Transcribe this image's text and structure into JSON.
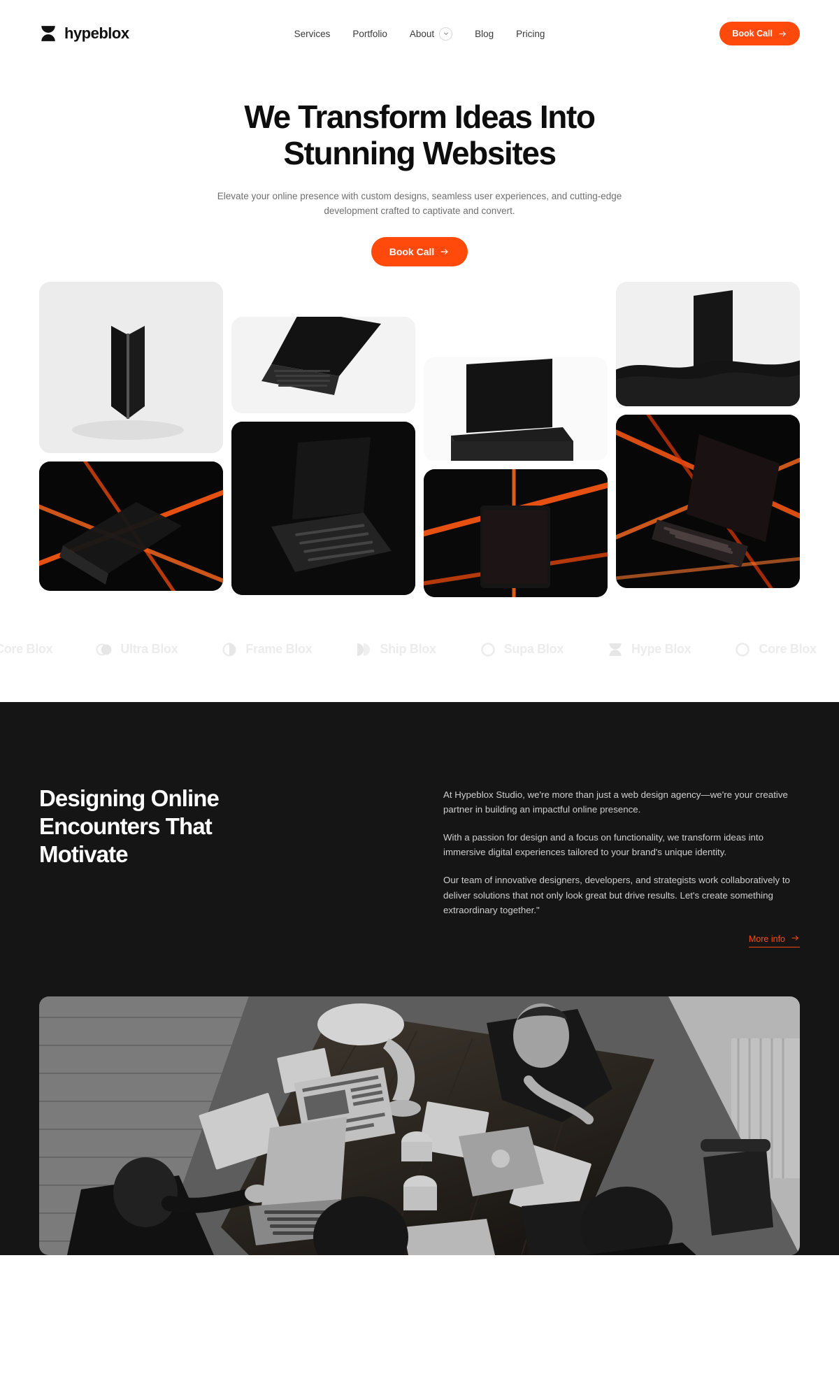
{
  "header": {
    "logo_icon": "hourglass-icon",
    "brand": "hypeblox",
    "nav": [
      {
        "label": "Services",
        "has_dropdown": false
      },
      {
        "label": "Portfolio",
        "has_dropdown": false
      },
      {
        "label": "About",
        "has_dropdown": true,
        "dropdown_icon": "chevron-down-icon"
      },
      {
        "label": "Blog",
        "has_dropdown": false
      },
      {
        "label": "Pricing",
        "has_dropdown": false
      }
    ],
    "cta": {
      "label": "Book Call",
      "icon": "arrow-right-icon"
    }
  },
  "hero": {
    "title_line1": "We Transform Ideas Into",
    "title_line2": "Stunning Websites",
    "subtitle": "Elevate your online presence with custom designs, seamless user experiences, and cutting-edge development crafted to captivate and convert.",
    "cta": {
      "label": "Book Call",
      "icon": "arrow-right-icon"
    }
  },
  "gallery": {
    "tiles": [
      {
        "id": "tile-1",
        "alt": "folded-black-phone-on-light-background",
        "style": "light"
      },
      {
        "id": "tile-2",
        "alt": "open-black-laptop-angled-on-light-background",
        "style": "light"
      },
      {
        "id": "tile-3",
        "alt": "black-laptop-standing-on-stone-block",
        "style": "light"
      },
      {
        "id": "tile-4",
        "alt": "black-phone-standing-on-fur-surface",
        "style": "light"
      },
      {
        "id": "tile-5",
        "alt": "laptop-with-orange-neon-light-streaks",
        "style": "dark"
      },
      {
        "id": "tile-6",
        "alt": "open-laptop-in-dark-studio-lighting",
        "style": "dark"
      },
      {
        "id": "tile-7",
        "alt": "tablet-with-orange-neon-light-streaks",
        "style": "dark"
      },
      {
        "id": "tile-8",
        "alt": "laptop-with-red-neon-light-streaks",
        "style": "dark"
      }
    ]
  },
  "marquee": {
    "items": [
      {
        "label": "Core Blox",
        "icon": "circle-outline-icon"
      },
      {
        "label": "Ultra Blox",
        "icon": "two-circles-icon"
      },
      {
        "label": "Frame Blox",
        "icon": "half-circle-icon"
      },
      {
        "label": "Ship Blox",
        "icon": "double-chevron-icon"
      },
      {
        "label": "Supa Blox",
        "icon": "circle-outline-icon"
      },
      {
        "label": "Hype Blox",
        "icon": "hourglass-icon"
      },
      {
        "label": "Core Blox",
        "icon": "circle-outline-icon"
      }
    ]
  },
  "about": {
    "title_line1": "Designing Online",
    "title_line2": "Encounters That",
    "title_line3": "Motivate",
    "paragraphs": [
      "At Hypeblox Studio, we're more than just a web design agency—we're your creative partner in building an impactful online presence.",
      "With a passion for design and a focus on functionality, we transform ideas into immersive digital experiences tailored to your brand's unique identity.",
      "Our team of innovative designers, developers, and strategists work collaboratively to deliver solutions that not only look great but drive results. Let's create something extraordinary together.\""
    ],
    "more_info": {
      "label": "More info",
      "icon": "arrow-right-icon"
    },
    "team_photo_alt": "black-and-white-overhead-photo-of-team-working-at-a-desk-with-laptops"
  },
  "colors": {
    "accent": "#FF4A0C",
    "dark_bg": "#151515",
    "light_bg": "#FFFFFF",
    "muted_text": "#6F6F6F"
  }
}
